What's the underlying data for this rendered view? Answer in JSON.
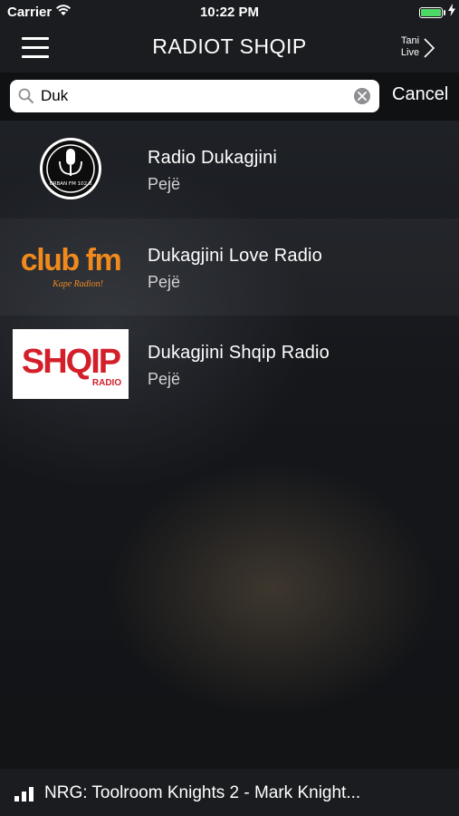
{
  "status_bar": {
    "carrier": "Carrier",
    "time": "10:22 PM",
    "battery_level": 1.0
  },
  "nav": {
    "title": "RADIOT SHQIP",
    "live_label_line1": "Tani",
    "live_label_line2": "Live"
  },
  "search": {
    "value": "Duk",
    "cancel_label": "Cancel"
  },
  "results": [
    {
      "name": "Radio Dukagjini",
      "city": "Pejë",
      "logo_text": "URBAN FM 102.3"
    },
    {
      "name": "Dukagjini Love Radio",
      "city": "Pejë",
      "logo_text": "club fm",
      "logo_subtext": "Kape Radion!"
    },
    {
      "name": "Dukagjini Shqip Radio",
      "city": "Pejë",
      "logo_text": "SHQIP",
      "logo_subtext": "RADIO"
    }
  ],
  "now_playing": {
    "text": "NRG: Toolroom Knights 2 - Mark Knight..."
  },
  "colors": {
    "battery": "#4cd964",
    "clubfm_orange": "#f08a1c",
    "shqip_red": "#d31f2a"
  }
}
